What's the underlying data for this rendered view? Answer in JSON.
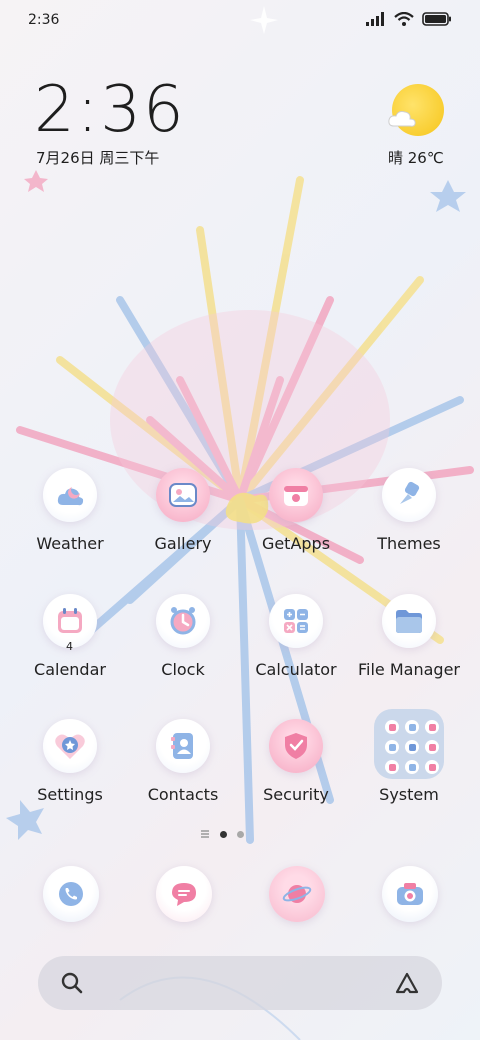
{
  "status_bar": {
    "time": "2:36"
  },
  "clock_widget": {
    "time": "2:36",
    "date": "7月26日 周三下午"
  },
  "weather_widget": {
    "text": "晴 26℃"
  },
  "apps": [
    {
      "label": "Weather",
      "icon": "weather-icon"
    },
    {
      "label": "Gallery",
      "icon": "gallery-icon"
    },
    {
      "label": "GetApps",
      "icon": "getapps-icon"
    },
    {
      "label": "Themes",
      "icon": "themes-icon"
    },
    {
      "label": "Calendar",
      "icon": "calendar-icon",
      "badge": "4"
    },
    {
      "label": "Clock",
      "icon": "clock-icon"
    },
    {
      "label": "Calculator",
      "icon": "calculator-icon"
    },
    {
      "label": "File Manager",
      "icon": "file-manager-icon"
    },
    {
      "label": "Settings",
      "icon": "settings-icon"
    },
    {
      "label": "Contacts",
      "icon": "contacts-icon"
    },
    {
      "label": "Security",
      "icon": "security-icon"
    },
    {
      "label": "System",
      "icon": "folder-icon"
    }
  ],
  "dock": [
    "phone-icon",
    "messages-icon",
    "browser-icon",
    "camera-icon"
  ],
  "page_indicator": {
    "pages": 2,
    "current": 1
  },
  "colors": {
    "pink": "#f2a6c0",
    "blue": "#a9c6ea",
    "yellow": "#f4e08f",
    "text": "#1e1e1e"
  }
}
